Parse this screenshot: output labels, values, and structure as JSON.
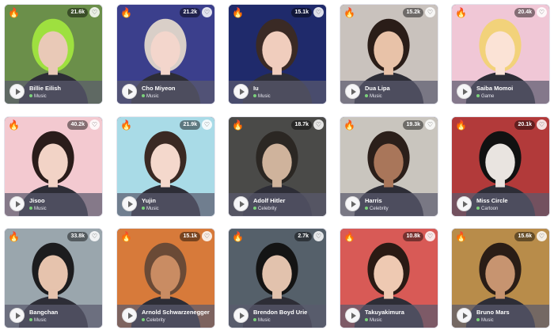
{
  "ui": {
    "fire_icon": "🔥",
    "heart_icon": "♡"
  },
  "cards": [
    {
      "name": "Billie Eilish",
      "count": "21.6k",
      "category": "Music",
      "bg": "#6b8f4a",
      "hair": "#9ee03f",
      "skin": "#e9c9b7"
    },
    {
      "name": "Cho Miyeon",
      "count": "21.2k",
      "category": "Music",
      "bg": "#3b3f8c",
      "hair": "#d9cfc8",
      "skin": "#f3d6cc"
    },
    {
      "name": "Iu",
      "count": "15.1k",
      "category": "Music",
      "bg": "#1f2a6b",
      "hair": "#3a2a25",
      "skin": "#f0cdbd"
    },
    {
      "name": "Dua Lipa",
      "count": "15.2k",
      "category": "Music",
      "bg": "#c9c2bd",
      "hair": "#2a1d18",
      "skin": "#e8c2a8"
    },
    {
      "name": "Saiba Momoi",
      "count": "20.4k",
      "category": "Game",
      "bg": "#f0c7d6",
      "hair": "#f2d27a",
      "skin": "#fbe3d6"
    },
    {
      "name": "Jisoo",
      "count": "40.2k",
      "category": "Music",
      "bg": "#f3c9d0",
      "hair": "#2a1c1a",
      "skin": "#f2d3c6"
    },
    {
      "name": "Yujin",
      "count": "21.9k",
      "category": "Music",
      "bg": "#a9dbe7",
      "hair": "#3a2923",
      "skin": "#f4d8cc"
    },
    {
      "name": "Adolf Hitler",
      "count": "18.7k",
      "category": "Celebrity",
      "bg": "#4a4a48",
      "hair": "#2b2723",
      "skin": "#cfb39c"
    },
    {
      "name": "Harris",
      "count": "19.3k",
      "category": "Celebrity",
      "bg": "#c9c5be",
      "hair": "#2b1f1a",
      "skin": "#a9765a"
    },
    {
      "name": "Miss Circle",
      "count": "20.1k",
      "category": "Cartoon",
      "bg": "#b23a3a",
      "hair": "#111111",
      "skin": "#e9e4e0"
    },
    {
      "name": "Bangchan",
      "count": "33.8k",
      "category": "Music",
      "bg": "#9aa6ad",
      "hair": "#1c1c1e",
      "skin": "#e6c3ad"
    },
    {
      "name": "Arnold Schwarzenegger",
      "count": "15.1k",
      "category": "Celebrity",
      "bg": "#d77a3a",
      "hair": "#6a4a36",
      "skin": "#c98c63"
    },
    {
      "name": "Brendon Boyd Urie",
      "count": "2.7k",
      "category": "Music",
      "bg": "#55606a",
      "hair": "#141414",
      "skin": "#e2c2ad"
    },
    {
      "name": "Takuyakimura",
      "count": "10.8k",
      "category": "Music",
      "bg": "#d85a56",
      "hair": "#2a1a14",
      "skin": "#eec9b2"
    },
    {
      "name": "Bruno Mars",
      "count": "15.6k",
      "category": "Music",
      "bg": "#b88c4a",
      "hair": "#2a1d16",
      "skin": "#c79470"
    }
  ]
}
